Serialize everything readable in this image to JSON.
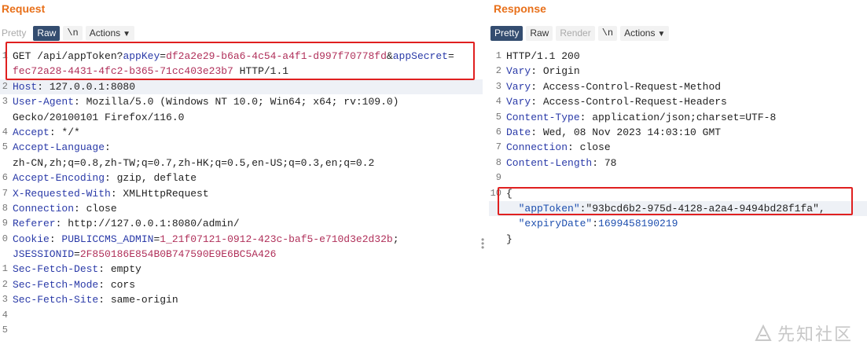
{
  "request": {
    "title": "Request",
    "tabs": {
      "pretty": "Pretty",
      "raw": "Raw",
      "newline": "\\n",
      "actions": "Actions"
    },
    "lines": [
      {
        "num": "1",
        "parts": [
          [
            "GET /api/appToken?",
            "t"
          ],
          [
            "appKey",
            "k"
          ],
          [
            "=",
            "t"
          ],
          [
            "df2a2e29-b6a6-4c54-a4f1-d997f70778fd",
            "v"
          ],
          [
            "&",
            "t"
          ],
          [
            "appSecret",
            "k"
          ],
          [
            "=",
            "t"
          ]
        ]
      },
      {
        "num": "",
        "parts": [
          [
            "fec72a28-4431-4fc2-b365-71cc403e23b7",
            "v"
          ],
          [
            " HTTP/1.1",
            "t"
          ]
        ]
      },
      {
        "num": "2",
        "parts": [
          [
            "Host",
            "k"
          ],
          [
            ": 127.0.0.1:8080",
            "t"
          ]
        ]
      },
      {
        "num": "3",
        "parts": [
          [
            "User-Agent",
            "k"
          ],
          [
            ": Mozilla/5.0 (Windows NT 10.0; Win64; x64; rv:109.0)",
            "t"
          ]
        ]
      },
      {
        "num": "",
        "parts": [
          [
            "Gecko/20100101 Firefox/116.0",
            "t"
          ]
        ]
      },
      {
        "num": "4",
        "parts": [
          [
            "Accept",
            "k"
          ],
          [
            ": */*",
            "t"
          ]
        ]
      },
      {
        "num": "5",
        "parts": [
          [
            "Accept-Language",
            "k"
          ],
          [
            ":",
            "t"
          ]
        ]
      },
      {
        "num": "",
        "parts": [
          [
            "zh-CN,zh;q=0.8,zh-TW;q=0.7,zh-HK;q=0.5,en-US;q=0.3,en;q=0.2",
            "t"
          ]
        ]
      },
      {
        "num": "6",
        "parts": [
          [
            "Accept-Encoding",
            "k"
          ],
          [
            ": gzip, deflate",
            "t"
          ]
        ]
      },
      {
        "num": "7",
        "parts": [
          [
            "X-Requested-With",
            "k"
          ],
          [
            ": XMLHttpRequest",
            "t"
          ]
        ]
      },
      {
        "num": "8",
        "parts": [
          [
            "Connection",
            "k"
          ],
          [
            ": close",
            "t"
          ]
        ]
      },
      {
        "num": "9",
        "parts": [
          [
            "Referer",
            "k"
          ],
          [
            ": http://127.0.0.1:8080/admin/",
            "t"
          ]
        ]
      },
      {
        "num": "0",
        "parts": [
          [
            "Cookie",
            "k"
          ],
          [
            ": ",
            "t"
          ],
          [
            "PUBLICCMS_ADMIN",
            "k"
          ],
          [
            "=",
            "t"
          ],
          [
            "1_21f07121-0912-423c-baf5-e710d3e2d32b",
            "v"
          ],
          [
            ";",
            "t"
          ]
        ]
      },
      {
        "num": "",
        "parts": [
          [
            "JSESSIONID",
            "k"
          ],
          [
            "=",
            "t"
          ],
          [
            "2F850186E854B0B747590E9E6BC5A426",
            "v"
          ]
        ]
      },
      {
        "num": "1",
        "parts": [
          [
            "Sec-Fetch-Dest",
            "k"
          ],
          [
            ": empty",
            "t"
          ]
        ]
      },
      {
        "num": "2",
        "parts": [
          [
            "Sec-Fetch-Mode",
            "k"
          ],
          [
            ": cors",
            "t"
          ]
        ]
      },
      {
        "num": "3",
        "parts": [
          [
            "Sec-Fetch-Site",
            "k"
          ],
          [
            ": same-origin",
            "t"
          ]
        ]
      },
      {
        "num": "4",
        "parts": []
      },
      {
        "num": "5",
        "parts": []
      }
    ]
  },
  "response": {
    "title": "Response",
    "tabs": {
      "pretty": "Pretty",
      "raw": "Raw",
      "render": "Render",
      "newline": "\\n",
      "actions": "Actions"
    },
    "lines": [
      {
        "num": "1",
        "parts": [
          [
            "HTTP/1.1 200",
            "t"
          ]
        ]
      },
      {
        "num": "2",
        "parts": [
          [
            "Vary",
            "k"
          ],
          [
            ": Origin",
            "t"
          ]
        ]
      },
      {
        "num": "3",
        "parts": [
          [
            "Vary",
            "k"
          ],
          [
            ": Access-Control-Request-Method",
            "t"
          ]
        ]
      },
      {
        "num": "4",
        "parts": [
          [
            "Vary",
            "k"
          ],
          [
            ": Access-Control-Request-Headers",
            "t"
          ]
        ]
      },
      {
        "num": "5",
        "parts": [
          [
            "Content-Type",
            "k"
          ],
          [
            ": application/json;charset=UTF-8",
            "t"
          ]
        ]
      },
      {
        "num": "6",
        "parts": [
          [
            "Date",
            "k"
          ],
          [
            ": Wed, 08 Nov 2023 14:03:10 GMT",
            "t"
          ]
        ]
      },
      {
        "num": "7",
        "parts": [
          [
            "Connection",
            "k"
          ],
          [
            ": close",
            "t"
          ]
        ]
      },
      {
        "num": "8",
        "parts": [
          [
            "Content-Length",
            "k"
          ],
          [
            ": 78",
            "t"
          ]
        ]
      },
      {
        "num": "9",
        "parts": []
      },
      {
        "num": "10",
        "parts": [
          [
            "{",
            "t"
          ]
        ]
      },
      {
        "num": "",
        "parts": [
          [
            "  ",
            "t"
          ],
          [
            "\"appToken\"",
            "s"
          ],
          [
            ":\"93bcd6b2-975d-4128-a2a4-9494bd28f1fa\",",
            "t"
          ]
        ]
      },
      {
        "num": "",
        "parts": [
          [
            "  ",
            "t"
          ],
          [
            "\"expiryDate\"",
            "s"
          ],
          [
            ":",
            "t"
          ],
          [
            "1699458190219",
            "s"
          ]
        ]
      },
      {
        "num": "",
        "parts": [
          [
            "}",
            "t"
          ]
        ]
      }
    ]
  },
  "watermark": "先知社区",
  "colors": {
    "accent": "#e8701a",
    "active_tab": "#344d70",
    "highlight_box": "#e02020",
    "key": "#2a3aa8",
    "value": "#b0305a"
  }
}
